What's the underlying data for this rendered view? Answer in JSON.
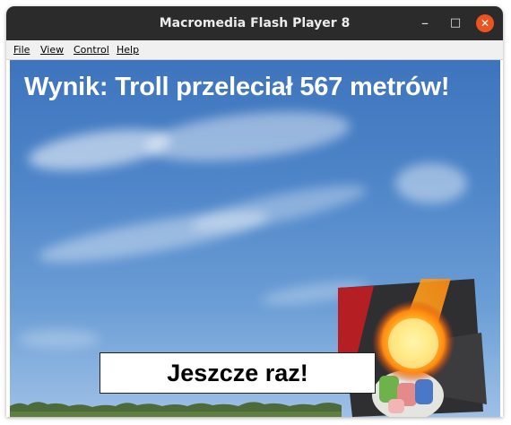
{
  "window": {
    "title": "Macromedia Flash Player 8",
    "min_icon": "minimize-icon",
    "max_icon": "maximize-icon",
    "close_icon": "close-icon",
    "close_color": "#e95420"
  },
  "menu": {
    "items": [
      {
        "label": "File"
      },
      {
        "label": "View"
      },
      {
        "label": "Control"
      },
      {
        "label": "Help"
      }
    ]
  },
  "game": {
    "score_text": "Wynik: Troll przeleciał 567 metrów!",
    "retry_label": "Jeszcze raz!",
    "sky_color": "#4f86c9",
    "fire_icon": "fireball-icon",
    "troll_icon": "troll-icon"
  }
}
